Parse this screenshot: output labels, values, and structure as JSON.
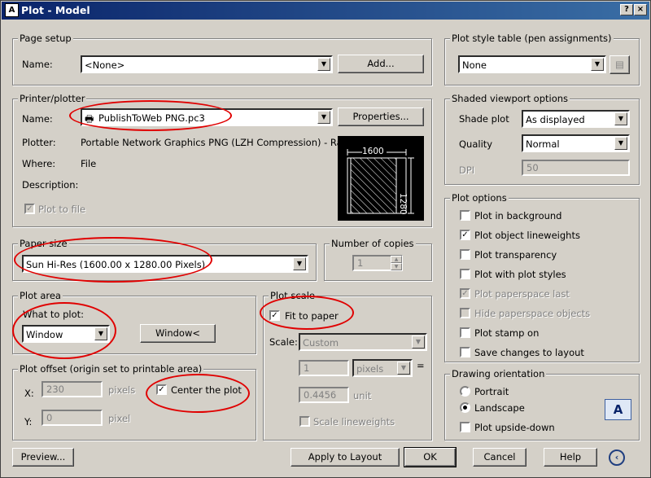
{
  "window": {
    "title": "Plot - Model",
    "app_icon": "A"
  },
  "page_setup": {
    "legend": "Page setup",
    "name_label": "Name:",
    "name_value": "<None>",
    "add_button": "Add..."
  },
  "printer": {
    "legend": "Printer/plotter",
    "name_label": "Name:",
    "name_value": "PublishToWeb PNG.pc3",
    "properties_button": "Properties...",
    "plotter_label": "Plotter:",
    "plotter_value": "Portable Network Graphics PNG (LZH Compression) - Ra...",
    "where_label": "Where:",
    "where_value": "File",
    "description_label": "Description:",
    "plot_to_file": "Plot to file",
    "preview_width": "1600",
    "preview_height": "1280"
  },
  "paper_size": {
    "legend": "Paper size",
    "value": "Sun Hi-Res (1600.00 x 1280.00 Pixels)"
  },
  "copies": {
    "legend": "Number of copies",
    "value": "1"
  },
  "plot_area": {
    "legend": "Plot area",
    "what_label": "What to plot:",
    "what_value": "Window",
    "window_button": "Window<"
  },
  "plot_offset": {
    "legend": "Plot offset (origin set to printable area)",
    "x_label": "X:",
    "x_value": "230",
    "x_unit": "pixels",
    "y_label": "Y:",
    "y_value": "0",
    "y_unit": "pixel",
    "center": "Center the plot"
  },
  "plot_scale": {
    "legend": "Plot scale",
    "fit": "Fit to paper",
    "scale_label": "Scale:",
    "scale_value": "Custom",
    "value1": "1",
    "unit1": "pixels",
    "equals": "=",
    "value2": "0.4456",
    "unit2": "unit",
    "scale_lineweights": "Scale lineweights"
  },
  "plot_style": {
    "legend": "Plot style table (pen assignments)",
    "value": "None"
  },
  "shaded": {
    "legend": "Shaded viewport options",
    "shade_label": "Shade plot",
    "shade_value": "As displayed",
    "quality_label": "Quality",
    "quality_value": "Normal",
    "dpi_label": "DPI",
    "dpi_value": "50"
  },
  "plot_options": {
    "legend": "Plot options",
    "items": [
      {
        "label": "Plot in background",
        "checked": false,
        "disabled": false
      },
      {
        "label": "Plot object lineweights",
        "checked": true,
        "disabled": false
      },
      {
        "label": "Plot transparency",
        "checked": false,
        "disabled": false
      },
      {
        "label": "Plot with plot styles",
        "checked": false,
        "disabled": false
      },
      {
        "label": "Plot paperspace last",
        "checked": true,
        "disabled": true
      },
      {
        "label": "Hide paperspace objects",
        "checked": false,
        "disabled": true
      },
      {
        "label": "Plot stamp on",
        "checked": false,
        "disabled": false
      },
      {
        "label": "Save changes to layout",
        "checked": false,
        "disabled": false
      }
    ]
  },
  "orientation": {
    "legend": "Drawing orientation",
    "portrait": "Portrait",
    "landscape": "Landscape",
    "upside_down": "Plot upside-down",
    "icon_letter": "A"
  },
  "footer": {
    "preview": "Preview...",
    "apply": "Apply to Layout",
    "ok": "OK",
    "cancel": "Cancel",
    "help": "Help"
  },
  "colors": {
    "annotation_ring": "#e00000",
    "title_bar": "#0a246a",
    "dialog_bg": "#d4d0c8"
  }
}
